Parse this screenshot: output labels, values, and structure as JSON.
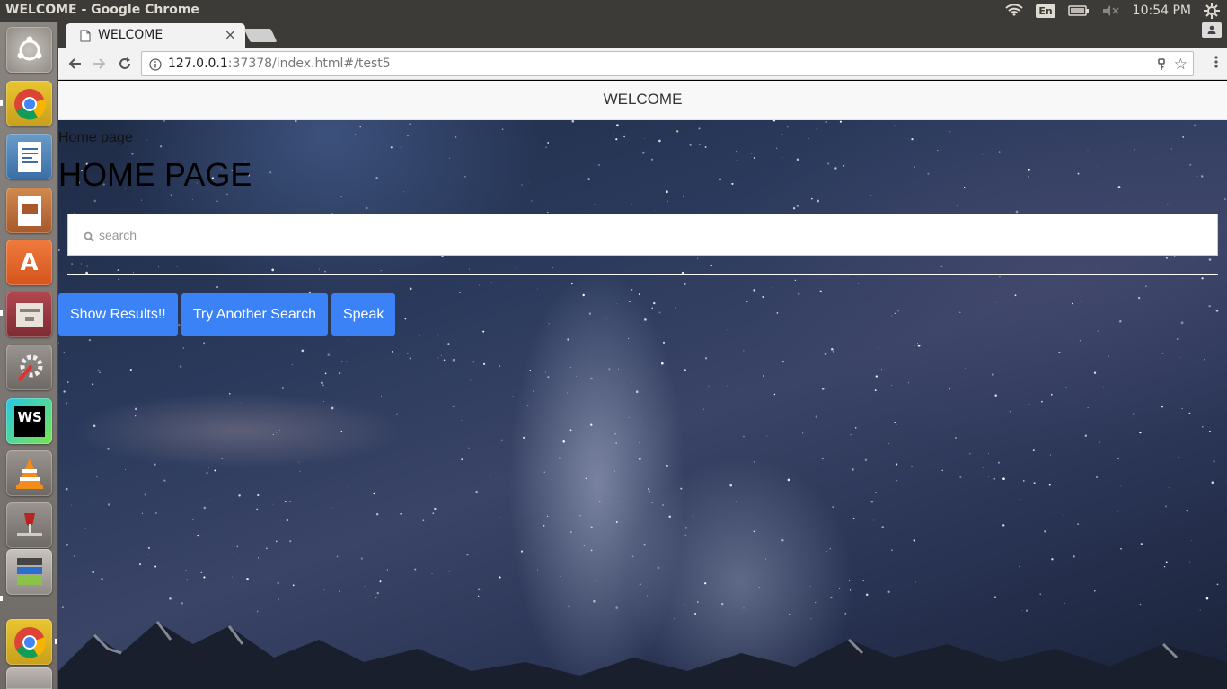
{
  "os": {
    "window_title": "WELCOME - Google Chrome",
    "keyboard_layout": "En",
    "clock": "10:54 PM"
  },
  "browser": {
    "tab_title": "WELCOME",
    "url_host": "127.0.0.1",
    "url_rest": ":37378/index.html#/test5"
  },
  "page": {
    "navbar_brand": "WELCOME",
    "breadcrumb": "Home page",
    "title": "HOME PAGE",
    "search": {
      "placeholder": "search",
      "value": ""
    },
    "buttons": {
      "show_results": "Show Results!!",
      "try_another": "Try Another Search",
      "speak": "Speak"
    }
  },
  "launcher": {
    "items": [
      "ubuntu-dash-icon",
      "chrome-icon",
      "writer-icon",
      "impress-icon",
      "software-center-icon",
      "files-icon",
      "system-settings-icon",
      "webstorm-icon",
      "vlc-icon",
      "wine-tools-icon",
      "chrome-icon",
      "trash-icon"
    ]
  },
  "colors": {
    "button_bg": "#3b82f6",
    "panel_bg": "#3c3b37"
  }
}
